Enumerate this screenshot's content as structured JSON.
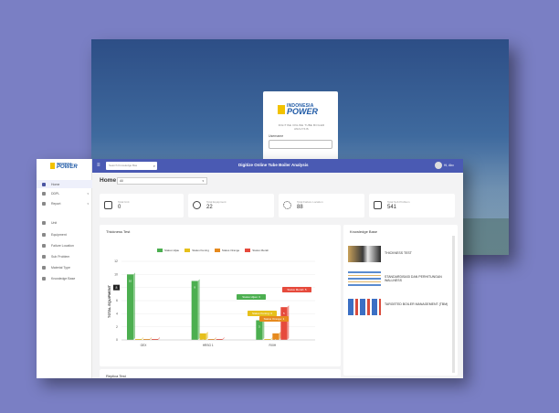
{
  "colors": {
    "accent": "#4a5ab3",
    "status_hijau": "#4caf50",
    "status_kuning": "#e6c01b",
    "status_orange": "#e68a1e",
    "status_merah": "#e64a3c"
  },
  "login": {
    "brand_top": "INDONESIA",
    "brand_main": "POWER",
    "brand_sub": "DIGITISE ONLINE TUBE BOILER ANALYSIS",
    "username_label": "Username"
  },
  "sidebar": {
    "brand_top": "INDONESIA",
    "brand_main": "POWER",
    "items": [
      {
        "label": "Home",
        "icon": "home-icon",
        "active": true
      },
      {
        "label": "DDPL",
        "icon": "ddpl-icon",
        "chevron": true
      },
      {
        "label": "Report",
        "icon": "report-icon",
        "chevron": true
      },
      {
        "label": "Unit",
        "icon": "unit-icon"
      },
      {
        "label": "Equipment",
        "icon": "equipment-icon"
      },
      {
        "label": "Failure Location",
        "icon": "failure-location-icon"
      },
      {
        "label": "Sub Problem",
        "icon": "sub-problem-icon"
      },
      {
        "label": "Material Type",
        "icon": "material-type-icon"
      },
      {
        "label": "Knowledge Base",
        "icon": "knowledge-base-icon"
      }
    ]
  },
  "topbar": {
    "search_placeholder": "Search Knowledge Bas",
    "title": "Digitize Online Tube Boiler Analysis",
    "user": "Hi, Abc"
  },
  "home": {
    "title": "Home",
    "filter": "All"
  },
  "cards": [
    {
      "label": "Total Unit",
      "value": "0",
      "icon": "unit-grid-icon"
    },
    {
      "label": "Total Equipment",
      "value": "22",
      "icon": "gear-icon"
    },
    {
      "label": "Total Failure Location",
      "value": "88",
      "icon": "location-icon"
    },
    {
      "label": "Total Sub Problem",
      "value": "541",
      "icon": "problem-icon"
    }
  ],
  "thickness_panel": {
    "title": "Thickness Test"
  },
  "knowledge_panel": {
    "title": "Knowledge Base",
    "items": [
      {
        "title": "THICKNESS TEST"
      },
      {
        "title": "STANDARDISASI DAN PERHITUNGAN WALLNESS"
      },
      {
        "title": "TARGETED BOILER MANAGEMENT (TBM)"
      }
    ]
  },
  "replica_panel": {
    "title": "Replica Test"
  },
  "chart_data": {
    "type": "bar",
    "title": "",
    "xlabel": "",
    "ylabel": "TOTAL EQUIPMENT",
    "ylim": [
      0,
      12
    ],
    "yticks": [
      0,
      2,
      4,
      6,
      8,
      10,
      12
    ],
    "categories": [
      "GEX",
      "HRSG 1",
      "RXIH"
    ],
    "series": [
      {
        "name": "Status Hijau",
        "color": "#4caf50",
        "values": [
          10,
          9,
          3
        ]
      },
      {
        "name": "Status Kuning",
        "color": "#e6c01b",
        "values": [
          0,
          1,
          0
        ]
      },
      {
        "name": "Status Orange",
        "color": "#e68a1e",
        "values": [
          0,
          0,
          1
        ]
      },
      {
        "name": "Status Merah",
        "color": "#e64a3c",
        "values": [
          0,
          0,
          5
        ]
      }
    ],
    "tooltips": [
      "Status Hijau: 3",
      "Status Kuning: 0",
      "Status Orange: 1",
      "Status Merah: 5"
    ],
    "marker_label": "8"
  }
}
